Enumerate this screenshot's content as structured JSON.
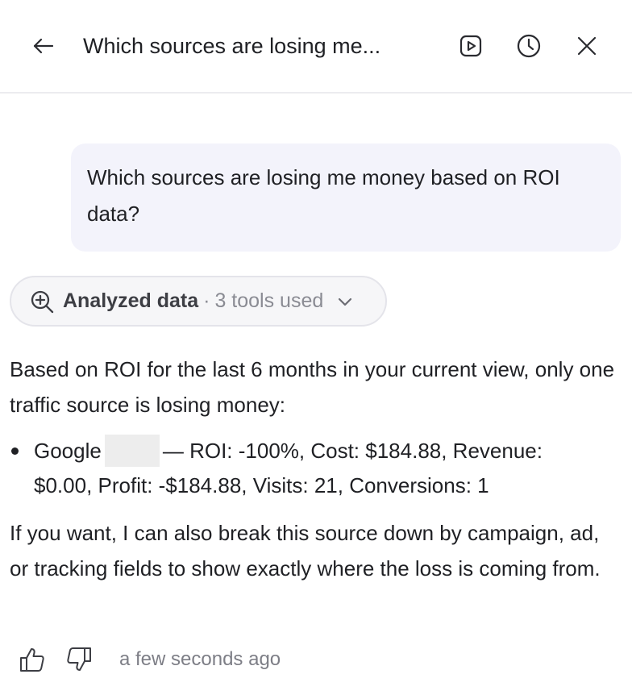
{
  "header": {
    "title": "Which sources are losing me...",
    "back_icon": "arrow-left-icon",
    "play_icon": "play-square-icon",
    "history_icon": "clock-icon",
    "close_icon": "close-icon"
  },
  "user_message": {
    "text": "Which sources are losing me money based on ROI data?"
  },
  "tools": {
    "label": "Analyzed data",
    "separator": "·",
    "count_text": "3 tools used",
    "icon": "zoom-in-icon",
    "chevron_icon": "chevron-down-icon"
  },
  "answer": {
    "intro": "Based on ROI for the last 6 months in your current view, only one traffic source is losing money:",
    "bullet": {
      "source_prefix": "Google",
      "details": "— ROI: -100%, Cost: $184.88, Revenue: $0.00, Profit: -$184.88, Visits: 21, Conversions: 1"
    },
    "followup": "If you want, I can also break this source down by campaign, ad, or tracking fields to show exactly where the loss is coming from."
  },
  "feedback": {
    "thumbs_up_icon": "thumbs-up-icon",
    "thumbs_down_icon": "thumbs-down-icon",
    "timestamp": "a few seconds ago"
  },
  "colors": {
    "bubble_bg": "#f3f3fb",
    "pill_bg": "#f6f6f8",
    "muted_text": "#8a8b93",
    "divider": "#ececef"
  }
}
